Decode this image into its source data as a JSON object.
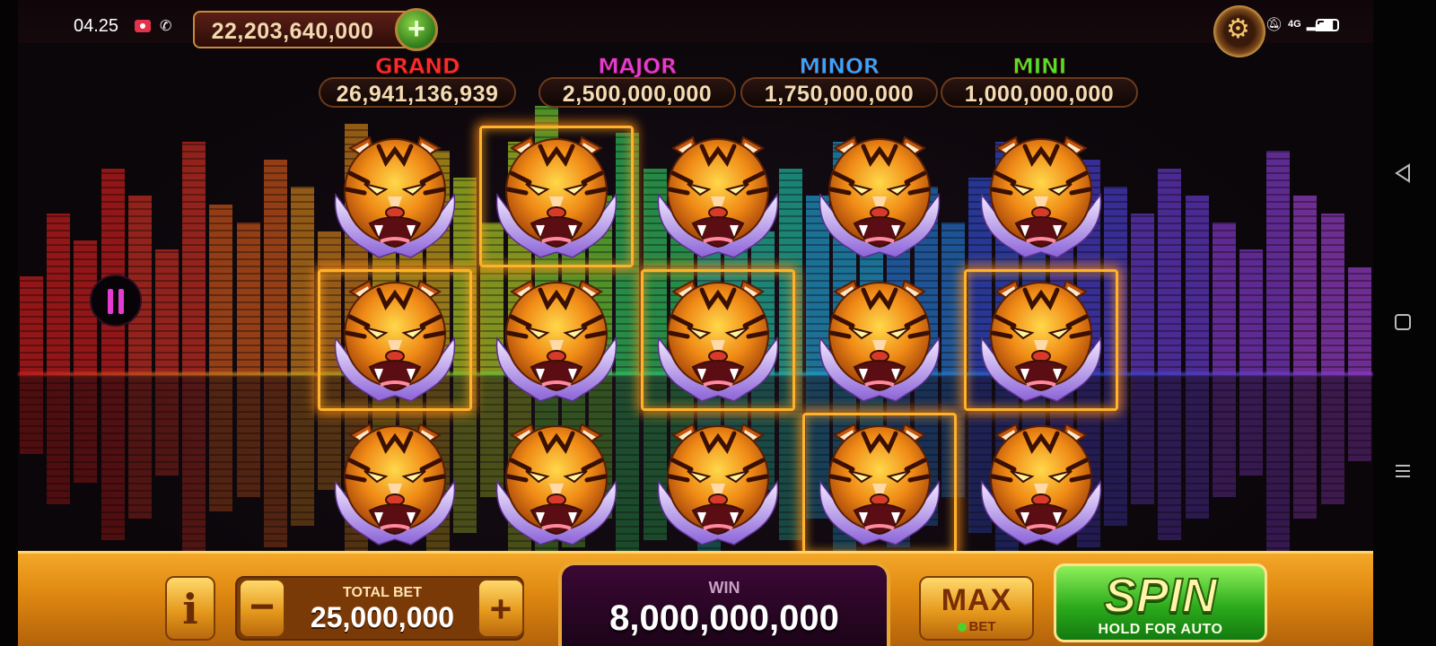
{
  "status_bar": {
    "time": "04.25",
    "network": "4G"
  },
  "balance": {
    "amount": "22,203,640,000",
    "add_label": "+"
  },
  "jackpots": [
    {
      "label": "GRAND",
      "value": "26,941,136,939",
      "color": "#ff2b2b"
    },
    {
      "label": "MAJOR",
      "value": "2,500,000,000",
      "color": "#e33cd6"
    },
    {
      "label": "MINOR",
      "value": "1,750,000,000",
      "color": "#36a6ff"
    },
    {
      "label": "MINI",
      "value": "1,000,000,000",
      "color": "#53e02a"
    }
  ],
  "reels": {
    "symbol": "tiger-head",
    "rows": 3,
    "cols": 5,
    "winning_cells": [
      [
        0,
        1
      ],
      [
        1,
        0
      ],
      [
        1,
        2
      ],
      [
        1,
        4
      ],
      [
        2,
        3
      ]
    ]
  },
  "controls": {
    "info_label": "i",
    "minus_label": "−",
    "plus_label": "+",
    "total_bet_label": "TOTAL BET",
    "total_bet_value": "25,000,000",
    "win_label": "WIN",
    "win_value": "8,000,000,000",
    "max_label": "MAX",
    "max_sub": "BET",
    "spin_label": "SPIN",
    "spin_sub": "HOLD FOR AUTO"
  },
  "colors": {
    "frame_glow": "#ffb22b",
    "spin_green": "#2cab1c",
    "panel_gold": "#e08a12"
  }
}
